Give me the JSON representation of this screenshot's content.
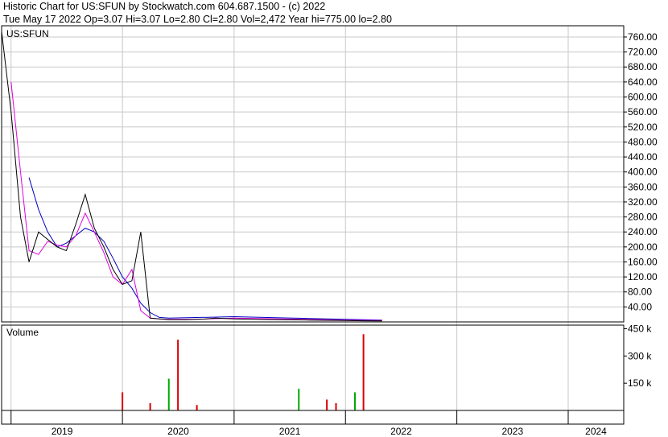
{
  "header": {
    "line1": "Historic Chart for US:SFUN by Stockwatch.com 604.687.1500 - (c) 2022",
    "line2": "Tue May 17 2022  Op=3.07  Hi=3.07  Lo=2.80  Cl=2.80  Vol=2,472  Year hi=775.00  lo=2.80"
  },
  "price_panel": {
    "symbol_label": "US:SFUN"
  },
  "volume_panel": {
    "label": "Volume"
  },
  "colors": {
    "price": "#000000",
    "ma_short": "#e000e0",
    "ma_long": "#0000c0",
    "grid": "#c8c8c8",
    "vol_up": "#00aa00",
    "vol_down": "#dd0000"
  },
  "chart_data": [
    {
      "type": "line",
      "title": "US:SFUN",
      "ylim": [
        0,
        790
      ],
      "y_ticks": [
        "760.00",
        "720.00",
        "680.00",
        "640.00",
        "600.00",
        "560.00",
        "520.00",
        "480.00",
        "440.00",
        "400.00",
        "360.00",
        "320.00",
        "280.00",
        "240.00",
        "200.00",
        "160.00",
        "120.00",
        "80.00",
        "40.00"
      ],
      "x_ticks": [
        "2019",
        "2020",
        "2021",
        "2022",
        "2023",
        "2024"
      ],
      "series": [
        {
          "x": [
            "2018-12",
            "2019-01",
            "2019-02",
            "2019-03",
            "2019-04",
            "2019-05",
            "2019-06",
            "2019-07",
            "2019-08",
            "2019-09",
            "2019-10",
            "2019-11",
            "2019-12",
            "2020-01",
            "2020-02",
            "2020-03",
            "2020-04",
            "2020-05",
            "2020-06",
            "2020-07",
            "2020-08",
            "2020-09",
            "2020-10",
            "2020-11",
            "2020-12",
            "2021-01",
            "2021-03",
            "2021-06",
            "2021-09",
            "2021-12",
            "2022-03",
            "2022-05"
          ],
          "values": [
            775,
            560,
            280,
            160,
            240,
            220,
            200,
            190,
            260,
            340,
            250,
            200,
            140,
            100,
            110,
            240,
            10,
            8,
            6,
            6,
            6,
            7,
            8,
            10,
            9,
            8,
            7,
            6,
            5,
            4,
            3,
            2.8
          ]
        },
        {
          "x": [
            "2019-01",
            "2019-02",
            "2019-03",
            "2019-04",
            "2019-05",
            "2019-06",
            "2019-07",
            "2019-08",
            "2019-09",
            "2019-10",
            "2019-11",
            "2019-12",
            "2020-01",
            "2020-02",
            "2020-03",
            "2020-04",
            "2020-05",
            "2020-06",
            "2020-09",
            "2021-01",
            "2021-06",
            "2022-01",
            "2022-05"
          ],
          "values": [
            640,
            400,
            190,
            180,
            215,
            205,
            200,
            230,
            290,
            240,
            185,
            120,
            100,
            140,
            30,
            10,
            8,
            7,
            7,
            10,
            8,
            5,
            4
          ]
        },
        {
          "x": [
            "2019-03",
            "2019-04",
            "2019-05",
            "2019-06",
            "2019-07",
            "2019-08",
            "2019-09",
            "2019-10",
            "2019-11",
            "2019-12",
            "2020-01",
            "2020-02",
            "2020-03",
            "2020-04",
            "2020-05",
            "2020-06",
            "2021-01",
            "2021-06",
            "2022-01",
            "2022-05"
          ],
          "values": [
            385,
            300,
            240,
            200,
            210,
            230,
            250,
            240,
            215,
            170,
            120,
            90,
            50,
            25,
            12,
            10,
            14,
            11,
            7,
            5
          ]
        }
      ]
    },
    {
      "type": "bar",
      "title": "Volume",
      "ylim": [
        0,
        470
      ],
      "y_ticks": [
        "450 k",
        "300 k",
        "150 k"
      ],
      "series": [
        {
          "x": [
            "2020-01",
            "2020-04",
            "2020-06",
            "2020-07",
            "2020-09",
            "2021-08",
            "2021-11",
            "2021-12",
            "2022-02",
            "2022-03"
          ],
          "values": [
            100,
            40,
            175,
            390,
            30,
            120,
            60,
            40,
            100,
            420
          ]
        }
      ]
    }
  ]
}
